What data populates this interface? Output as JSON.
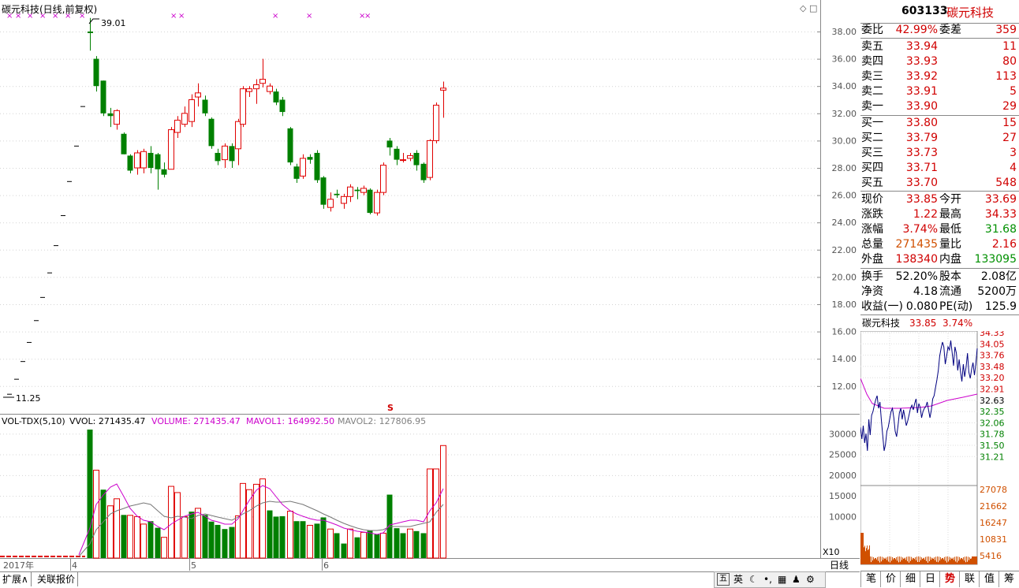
{
  "header": {
    "chart_title": "碳元科技(日线,前复权)",
    "diamond1": "◇",
    "diamond2": "□"
  },
  "price_axis": {
    "ticks": [
      "38.00",
      "36.00",
      "34.00",
      "32.00",
      "30.00",
      "28.00",
      "26.00",
      "24.00",
      "22.00",
      "20.00",
      "18.00",
      "16.00",
      "14.00",
      "12.00"
    ]
  },
  "annotations": {
    "high_label": "39.01",
    "low_label": "11.25",
    "s_marker": "S"
  },
  "volume_header": {
    "indicator": "VOL-TDX(5,10)",
    "vvol": "VVOL: 271435.47",
    "volume": "VOLUME: 271435.47",
    "mavol1": "MAVOL1: 164992.50",
    "mavol2": "MAVOL2: 127806.95"
  },
  "volume_axis": {
    "ticks": [
      "30000",
      "25000",
      "20000",
      "15000",
      "10000"
    ],
    "unit": "X10"
  },
  "date_axis": {
    "labels": [
      "2017年",
      "4",
      "5",
      "6"
    ]
  },
  "quote": {
    "code": "603133",
    "name": "碳元科技",
    "weibi_label": "委比",
    "weibi_value": "42.99%",
    "weicha_label": "委差",
    "weicha_value": "359",
    "asks": [
      {
        "label": "卖五",
        "price": "33.94",
        "vol": "11"
      },
      {
        "label": "卖四",
        "price": "33.93",
        "vol": "80"
      },
      {
        "label": "卖三",
        "price": "33.92",
        "vol": "113"
      },
      {
        "label": "卖二",
        "price": "33.91",
        "vol": "5"
      },
      {
        "label": "卖一",
        "price": "33.90",
        "vol": "29"
      }
    ],
    "bids": [
      {
        "label": "买一",
        "price": "33.80",
        "vol": "15"
      },
      {
        "label": "买二",
        "price": "33.79",
        "vol": "27"
      },
      {
        "label": "买三",
        "price": "33.73",
        "vol": "3"
      },
      {
        "label": "买四",
        "price": "33.71",
        "vol": "4"
      },
      {
        "label": "买五",
        "price": "33.70",
        "vol": "548"
      }
    ],
    "stats": [
      {
        "l1": "现价",
        "v1": "33.85",
        "c1": "red",
        "l2": "今开",
        "v2": "33.69",
        "c2": "red"
      },
      {
        "l1": "涨跌",
        "v1": "1.22",
        "c1": "red",
        "l2": "最高",
        "v2": "34.33",
        "c2": "red"
      },
      {
        "l1": "涨幅",
        "v1": "3.74%",
        "c1": "red",
        "l2": "最低",
        "v2": "31.68",
        "c2": "grn"
      },
      {
        "l1": "总量",
        "v1": "271435",
        "c1": "org",
        "l2": "量比",
        "v2": "2.16",
        "c2": "red"
      },
      {
        "l1": "外盘",
        "v1": "138340",
        "c1": "red",
        "l2": "内盘",
        "v2": "133095",
        "c2": "grn"
      }
    ],
    "fund": [
      {
        "l1": "换手",
        "v1": "52.20%",
        "l2": "股本",
        "v2": "2.08亿"
      },
      {
        "l1": "净资",
        "v1": "4.18",
        "l2": "流通",
        "v2": "5200万"
      },
      {
        "l1": "收益(一)",
        "v1": "0.080",
        "l2": "PE(动)",
        "v2": "125.9"
      }
    ]
  },
  "mini_chart": {
    "name": "碳元科技",
    "price": "33.85",
    "pct": "3.74%",
    "price_ticks": [
      {
        "v": "34.33",
        "c": "red"
      },
      {
        "v": "34.05",
        "c": "red"
      },
      {
        "v": "33.76",
        "c": "red"
      },
      {
        "v": "33.48",
        "c": "red"
      },
      {
        "v": "33.20",
        "c": "red"
      },
      {
        "v": "32.91",
        "c": "red"
      },
      {
        "v": "32.63",
        "c": "blk"
      },
      {
        "v": "32.35",
        "c": "grn"
      },
      {
        "v": "32.06",
        "c": "grn"
      },
      {
        "v": "31.78",
        "c": "grn"
      },
      {
        "v": "31.50",
        "c": "grn"
      },
      {
        "v": "31.21",
        "c": "grn"
      }
    ],
    "vol_ticks": [
      "27078",
      "21662",
      "16247",
      "10831",
      "5416"
    ]
  },
  "tabs": [
    "笔",
    "价",
    "细",
    "日",
    "势",
    "联",
    "值",
    "筹"
  ],
  "bottom": {
    "left_button": "扩展∧",
    "link_button": "关联报价",
    "period": "日线",
    "ime_text": "英"
  },
  "colors": {
    "up": "#e00000",
    "down": "#008000",
    "accent": "#cc00cc",
    "grid": "#c8c8c8"
  }
}
